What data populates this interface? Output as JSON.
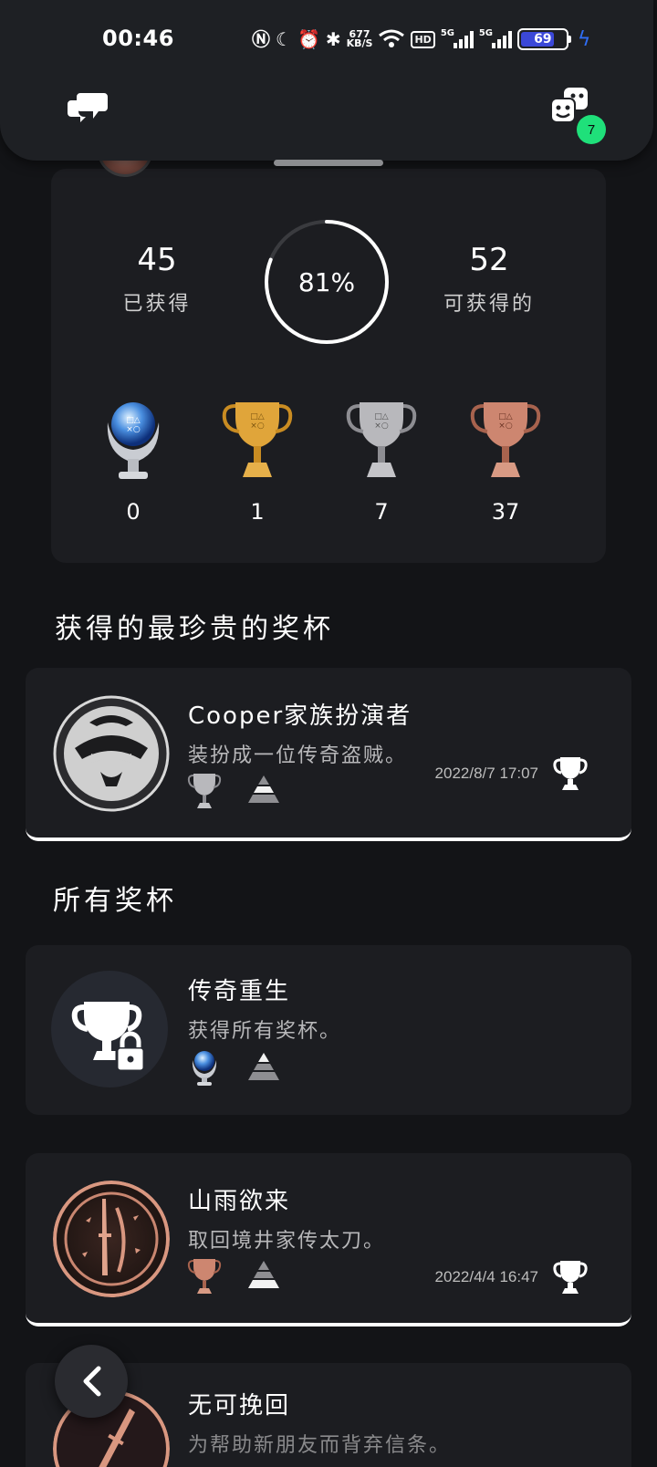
{
  "status_bar": {
    "time": "00:46",
    "net_speed_value": "677",
    "net_speed_unit": "KB/S",
    "hd_label": "HD",
    "signal1_label": "5G",
    "signal2_label": "5G",
    "battery_level": "69"
  },
  "top_bar": {
    "chat_icon": "chat-bubbles-icon",
    "games_icon": "game-faces-icon",
    "notification_count": "7"
  },
  "summary": {
    "earned_count": "45",
    "earned_label": "已获得",
    "progress_percent": "81%",
    "progress_fraction": 0.81,
    "available_count": "52",
    "available_label": "可获得的",
    "grades": [
      {
        "grade": "platinum",
        "count": "0"
      },
      {
        "grade": "gold",
        "count": "1"
      },
      {
        "grade": "silver",
        "count": "7"
      },
      {
        "grade": "bronze",
        "count": "37"
      }
    ]
  },
  "rarest_section": {
    "title": "获得的最珍贵的奖杯",
    "trophy": {
      "name": "Cooper家族扮演者",
      "description": "装扮成一位传奇盗贼。",
      "grade": "silver",
      "earned_date": "2022/8/7  17:07"
    }
  },
  "all_section": {
    "title": "所有奖杯",
    "trophies": [
      {
        "name": "传奇重生",
        "description": "获得所有奖杯。",
        "grade": "platinum",
        "locked": true
      },
      {
        "name": "山雨欲来",
        "description": "取回境井家传太刀。",
        "grade": "bronze",
        "earned_date": "2022/4/4  16:47"
      },
      {
        "name": "无可挽回",
        "description": "为帮助新朋友而背弃信条。",
        "grade": "bronze"
      }
    ]
  },
  "colors": {
    "background": "#131417",
    "card": "#1c1d21",
    "badge": "#1fe07a",
    "platinum": "#9fc8ee",
    "gold": "#e0a53a",
    "silver": "#b8b8bc",
    "bronze": "#cd8670"
  }
}
